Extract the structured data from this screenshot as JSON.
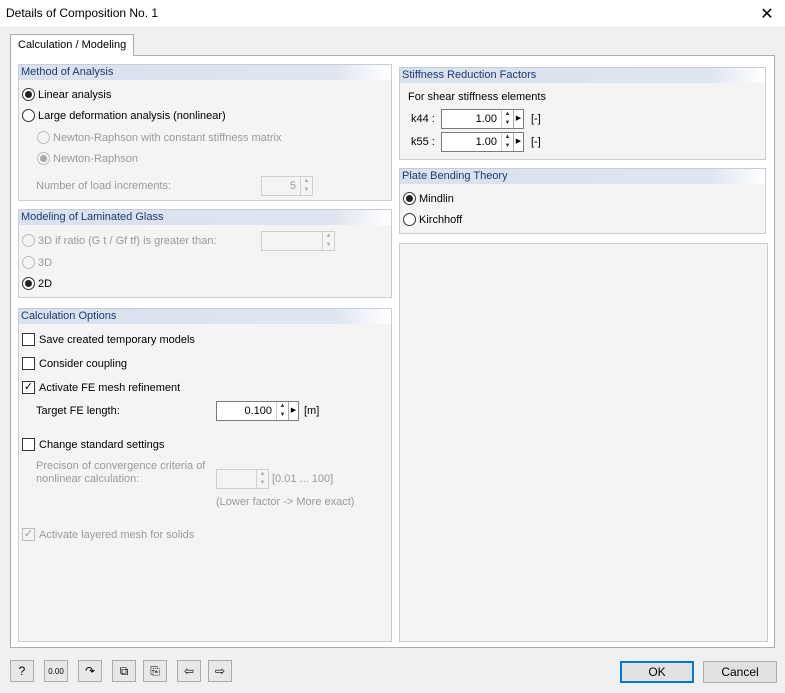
{
  "window": {
    "title": "Details of Composition No. 1",
    "close_glyph": "✕"
  },
  "tab": {
    "label": "Calculation / Modeling"
  },
  "method": {
    "header": "Method of Analysis",
    "linear": "Linear analysis",
    "large": "Large deformation analysis (nonlinear)",
    "newton_const": "Newton-Raphson with constant stiffness matrix",
    "newton": "Newton-Raphson",
    "increments_label": "Number of load increments:",
    "increments_value": "5"
  },
  "glass": {
    "header": "Modeling of Laminated Glass",
    "opt3d_ratio": "3D if ratio (G t / Gf tf) is greater than:",
    "ratio_value": "",
    "opt3d": "3D",
    "opt2d": "2D"
  },
  "calc": {
    "header": "Calculation Options",
    "save_temp": "Save created temporary models",
    "coupling": "Consider coupling",
    "fe_refine": "Activate FE mesh refinement",
    "fe_length_label": "Target FE length:",
    "fe_length_value": "0.100",
    "fe_length_unit": "[m]",
    "change_std": "Change standard settings",
    "precision_label1": "Precison of convergence criteria of",
    "precision_label2": "nonlinear calculation:",
    "precision_value": "",
    "precision_range": "[0.01 ... 100]",
    "precision_hint": "(Lower factor -> More exact)",
    "layered": "Activate layered mesh for solids"
  },
  "stiffness": {
    "header": "Stiffness Reduction Factors",
    "sub": "For shear stiffness elements",
    "k44_label": "k44 :",
    "k44_value": "1.00",
    "k55_label": "k55 :",
    "k55_value": "1.00",
    "unit": "[-]"
  },
  "plate": {
    "header": "Plate Bending Theory",
    "mindlin": "Mindlin",
    "kirchhoff": "Kirchhoff"
  },
  "buttons": {
    "ok": "OK",
    "cancel": "Cancel"
  },
  "toolbar_icons": [
    "help-icon",
    "units-icon",
    "redo-icon",
    "copy-icon",
    "paste-icon",
    "import-icon",
    "export-icon"
  ],
  "toolbar_units_text": "0.00"
}
